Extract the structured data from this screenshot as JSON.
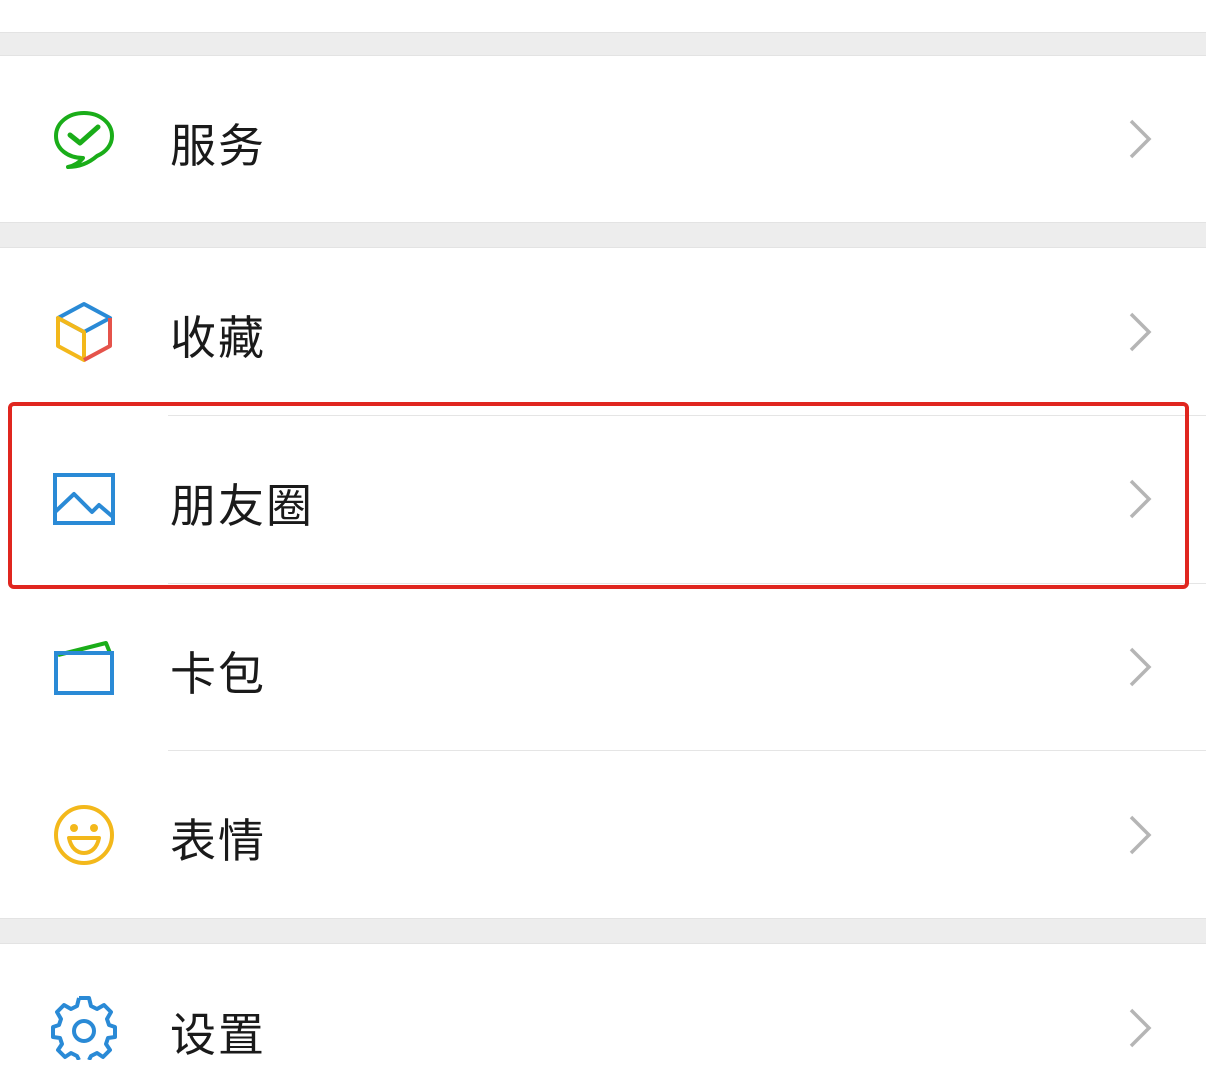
{
  "menu": {
    "items": [
      {
        "id": "services",
        "label": "服务",
        "icon": "wechat-pay-icon"
      },
      {
        "id": "favorites",
        "label": "收藏",
        "icon": "cube-icon"
      },
      {
        "id": "moments",
        "label": "朋友圈",
        "icon": "picture-icon"
      },
      {
        "id": "cards",
        "label": "卡包",
        "icon": "wallet-icon"
      },
      {
        "id": "stickers",
        "label": "表情",
        "icon": "smiley-icon"
      },
      {
        "id": "settings",
        "label": "设置",
        "icon": "gear-icon"
      }
    ]
  },
  "colors": {
    "background_gap": "#ededed",
    "highlight_border": "#e0261f",
    "wechat_green": "#1aad19",
    "blue_icon": "#2a8ad6",
    "yellow_icon": "#f3b81b",
    "chevron": "#b5b5b5"
  }
}
